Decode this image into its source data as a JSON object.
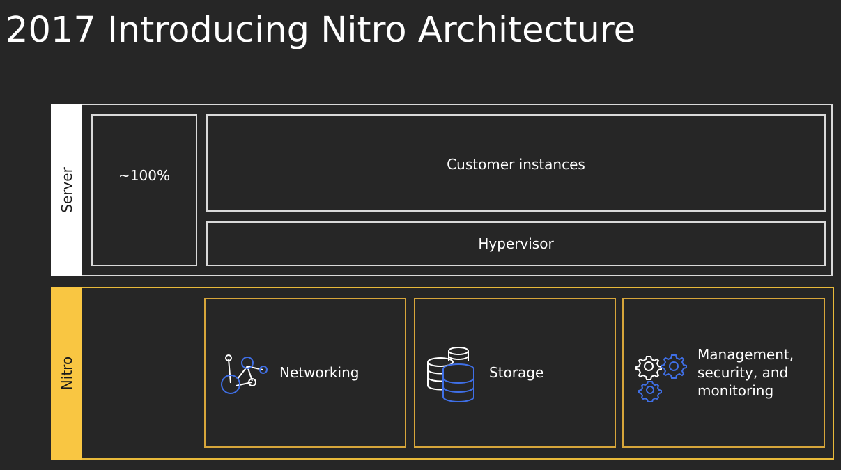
{
  "slide": {
    "title": "2017 Introducing Nitro Architecture"
  },
  "server": {
    "label": "Server",
    "percent_box": "~100%",
    "customer_instances": "Customer instances",
    "hypervisor": "Hypervisor"
  },
  "nitro": {
    "label": "Nitro",
    "cards": [
      {
        "label": "Networking",
        "icon": "network-nodes-icon"
      },
      {
        "label": "Storage",
        "icon": "database-stack-icon"
      },
      {
        "label_lines": [
          "Management,",
          "security, and",
          "monitoring"
        ],
        "icon": "gears-icon"
      }
    ]
  },
  "colors": {
    "background": "#262626",
    "server_bar": "#ffffff",
    "nitro_bar": "#f9c642",
    "nitro_border": "#d6a53a",
    "icon_blue": "#3f6fe6"
  }
}
